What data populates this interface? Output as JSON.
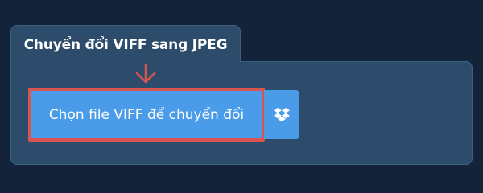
{
  "panel": {
    "title": "Chuyển đổi VIFF sang JPEG"
  },
  "upload": {
    "choose_label": "Chọn file VIFF để chuyển đổi"
  },
  "icons": {
    "arrow": "arrow-down-icon",
    "dropbox": "dropbox-icon"
  },
  "colors": {
    "background": "#13233a",
    "panel": "#2d4c6b",
    "button": "#4a9ce8",
    "highlight": "#d9534f"
  }
}
